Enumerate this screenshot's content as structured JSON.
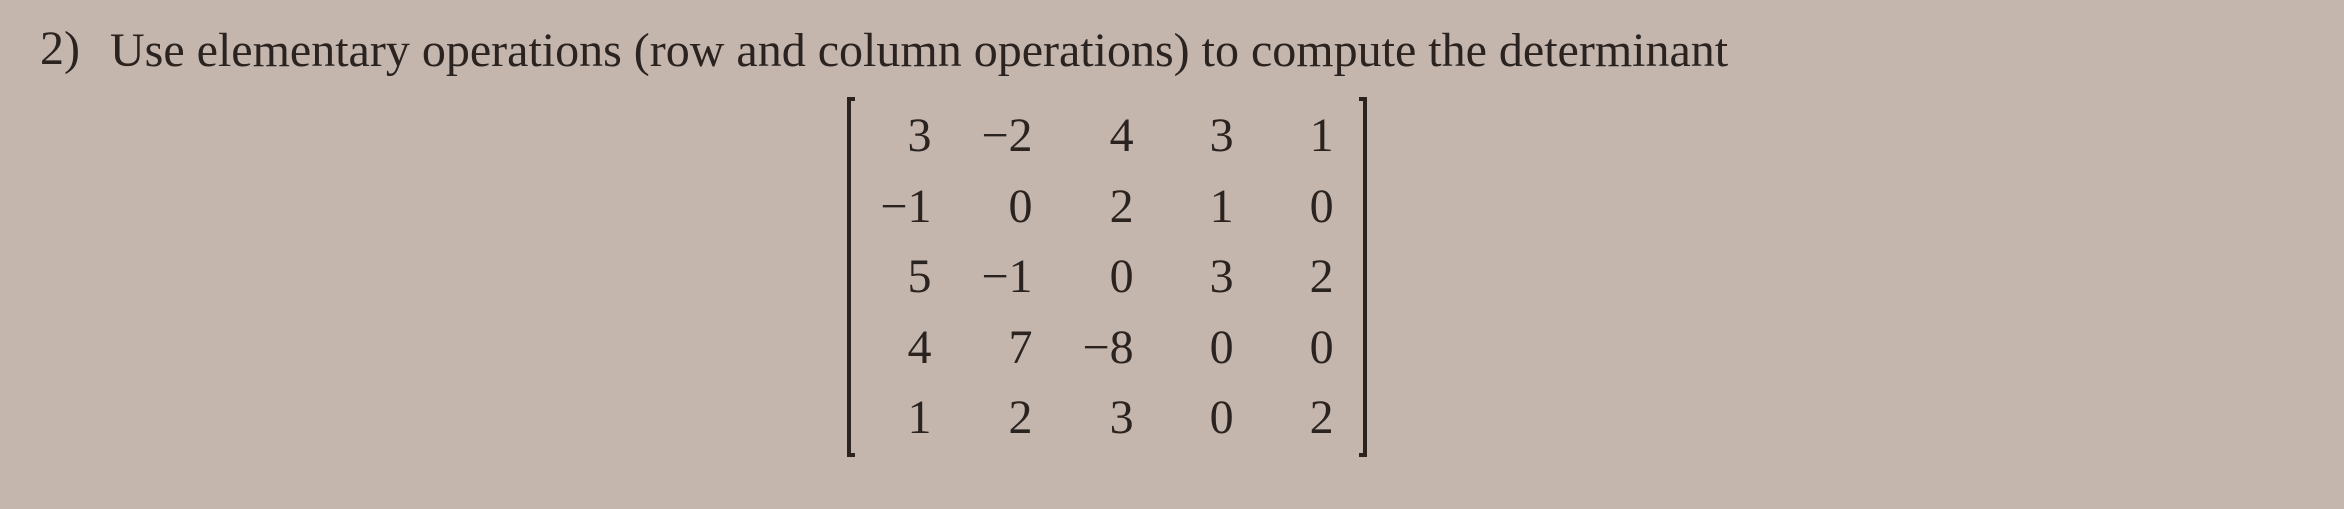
{
  "problem": {
    "number": "2)",
    "text": "Use elementary operations (row and column operations) to compute the determinant"
  },
  "matrix": {
    "rows": 5,
    "cols": 5,
    "r0c0": "3",
    "r0c1": "−2",
    "r0c2": "4",
    "r0c3": "3",
    "r0c4": "1",
    "r1c0": "−1",
    "r1c1": "0",
    "r1c2": "2",
    "r1c3": "1",
    "r1c4": "0",
    "r2c0": "5",
    "r2c1": "−1",
    "r2c2": "0",
    "r2c3": "3",
    "r2c4": "2",
    "r3c0": "4",
    "r3c1": "7",
    "r3c2": "−8",
    "r3c3": "0",
    "r3c4": "0",
    "r4c0": "1",
    "r4c1": "2",
    "r4c2": "3",
    "r4c3": "0",
    "r4c4": "2"
  }
}
